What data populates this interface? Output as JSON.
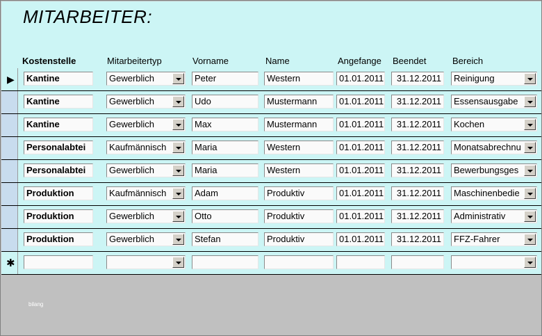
{
  "form": {
    "title": "MITARBEITER:",
    "footer_text": "bilang"
  },
  "columns": {
    "kostenstelle": "Kostenstelle",
    "mitarbeitertyp": "Mitarbeitertyp",
    "vorname": "Vorname",
    "name": "Name",
    "angefange": "Angefange",
    "beendet": "Beendet",
    "bereich": "Bereich"
  },
  "record_selector": {
    "current_glyph": "▶",
    "new_glyph": "✱"
  },
  "rows": [
    {
      "kostenstelle": "Kantine",
      "mitarbeitertyp": "Gewerblich",
      "vorname": "Peter",
      "name": "Western",
      "angefange": "01.01.2011",
      "beendet": "31.12.2011",
      "bereich": "Reinigung"
    },
    {
      "kostenstelle": "Kantine",
      "mitarbeitertyp": "Gewerblich",
      "vorname": "Udo",
      "name": "Mustermann",
      "angefange": "01.01.2011",
      "beendet": "31.12.2011",
      "bereich": "Essensausgabe"
    },
    {
      "kostenstelle": "Kantine",
      "mitarbeitertyp": "Gewerblich",
      "vorname": "Max",
      "name": "Mustermann",
      "angefange": "01.01.2011",
      "beendet": "31.12.2011",
      "bereich": "Kochen"
    },
    {
      "kostenstelle": "Personalabtei",
      "mitarbeitertyp": "Kaufmännisch",
      "vorname": "Maria",
      "name": "Western",
      "angefange": "01.01.2011",
      "beendet": "31.12.2011",
      "bereich": "Monatsabrechnu"
    },
    {
      "kostenstelle": "Personalabtei",
      "mitarbeitertyp": "Gewerblich",
      "vorname": "Maria",
      "name": "Western",
      "angefange": "01.01.2011",
      "beendet": "31.12.2011",
      "bereich": "Bewerbungsges"
    },
    {
      "kostenstelle": "Produktion",
      "mitarbeitertyp": "Kaufmännisch",
      "vorname": "Adam",
      "name": "Produktiv",
      "angefange": "01.01.2011",
      "beendet": "31.12.2011",
      "bereich": "Maschinenbedie"
    },
    {
      "kostenstelle": "Produktion",
      "mitarbeitertyp": "Gewerblich",
      "vorname": "Otto",
      "name": "Produktiv",
      "angefange": "01.01.2011",
      "beendet": "31.12.2011",
      "bereich": "Administrativ"
    },
    {
      "kostenstelle": "Produktion",
      "mitarbeitertyp": "Gewerblich",
      "vorname": "Stefan",
      "name": "Produktiv",
      "angefange": "01.01.2011",
      "beendet": "31.12.2011",
      "bereich": "FFZ-Fahrer"
    },
    {
      "kostenstelle": "",
      "mitarbeitertyp": "",
      "vorname": "",
      "name": "",
      "angefange": "",
      "beendet": "",
      "bereich": ""
    }
  ]
}
